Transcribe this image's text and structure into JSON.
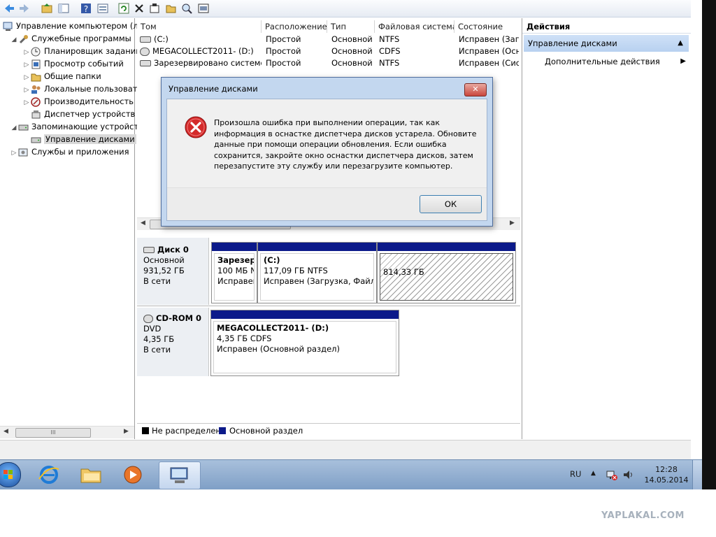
{
  "tree": {
    "items": [
      {
        "label": "Управление компьютером (л",
        "icon": "computer-management-icon"
      },
      {
        "label": "Служебные программы",
        "icon": "tools-icon"
      },
      {
        "label": "Планировщик заданий",
        "icon": "clock-icon"
      },
      {
        "label": "Просмотр событий",
        "icon": "event-viewer-icon"
      },
      {
        "label": "Общие папки",
        "icon": "shared-folder-icon"
      },
      {
        "label": "Локальные пользовате",
        "icon": "users-icon"
      },
      {
        "label": "Производительность",
        "icon": "performance-icon"
      },
      {
        "label": "Диспетчер устройств",
        "icon": "device-manager-icon"
      },
      {
        "label": "Запоминающие устройст",
        "icon": "storage-icon"
      },
      {
        "label": "Управление дисками",
        "icon": "disk-management-icon"
      },
      {
        "label": "Службы и приложения",
        "icon": "services-icon"
      }
    ],
    "scroll_thumb_label": "III"
  },
  "volumes": {
    "headers": [
      "Том",
      "Расположение",
      "Тип",
      "Файловая система",
      "Состояние"
    ],
    "rows": [
      {
        "name": "(C:)",
        "layout": "Простой",
        "type": "Основной",
        "fs": "NTFS",
        "status": "Исправен (Загр"
      },
      {
        "name": "MEGACOLLECT2011- (D:)",
        "layout": "Простой",
        "type": "Основной",
        "fs": "CDFS",
        "status": "Исправен (Осн"
      },
      {
        "name": "Зарезервировано системой",
        "layout": "Простой",
        "type": "Основной",
        "fs": "NTFS",
        "status": "Исправен (Сист"
      }
    ]
  },
  "disks": {
    "disk0": {
      "name": "Диск 0",
      "type": "Основной",
      "size": "931,52 ГБ",
      "status": "В сети"
    },
    "disk0_parts": [
      {
        "title": "Зарезерв",
        "size": "100 МБ N",
        "status": "Исправен"
      },
      {
        "title": "(C:)",
        "size": "117,09 ГБ NTFS",
        "status": "Исправен (Загрузка, Файл п"
      },
      {
        "size": "814,33 ГБ"
      }
    ],
    "cdrom0": {
      "name": "CD-ROM 0",
      "type": "DVD",
      "size": "4,35 ГБ",
      "status": "В сети"
    },
    "cdrom_part": {
      "title": "MEGACOLLECT2011-  (D:)",
      "size": "4,35 ГБ CDFS",
      "status": "Исправен (Основной раздел)"
    }
  },
  "legend": {
    "unallocated": "Не распределен",
    "primary": "Основной раздел"
  },
  "actions": {
    "header": "Действия",
    "section": "Управление дисками",
    "more": "Дополнительные действия"
  },
  "dialog": {
    "title": "Управление дисками",
    "message": "Произошла ошибка при выполнении операции, так как информация в оснастке диспетчера дисков устарела. Обновите данные при помощи операции обновления.  Если ошибка сохранится, закройте окно оснастки диспетчера дисков, затем перезапустите эту службу или перезагрузите компьютер.",
    "ok": "ОК"
  },
  "taskbar": {
    "lang": "RU",
    "time": "12:28",
    "date": "14.05.2014"
  },
  "watermark": "YAPLAKAL.COM",
  "colors": {
    "primary_partition": "#0c1a8a",
    "unallocated": "#000000",
    "error": "#d42a2a",
    "taskbar": "#8fadd3"
  }
}
